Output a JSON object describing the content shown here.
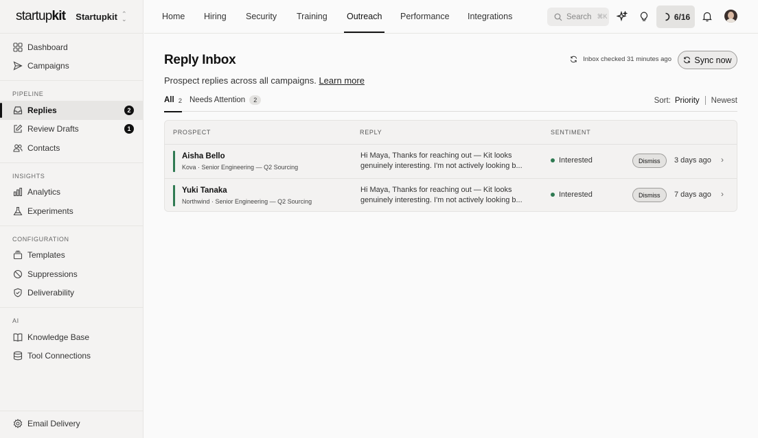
{
  "brand": {
    "logo_light": "startup",
    "logo_bold": "kit",
    "workspace": "Startupkit"
  },
  "sidebar": {
    "top_items": [
      {
        "label": "Dashboard",
        "icon": "grid-icon"
      },
      {
        "label": "Campaigns",
        "icon": "send-icon"
      }
    ],
    "sections": [
      {
        "title": "PIPELINE",
        "items": [
          {
            "label": "Replies",
            "icon": "inbox-icon",
            "badge": "2",
            "active": true
          },
          {
            "label": "Review Drafts",
            "icon": "edit-icon",
            "badge": "1"
          },
          {
            "label": "Contacts",
            "icon": "users-icon"
          }
        ]
      },
      {
        "title": "INSIGHTS",
        "items": [
          {
            "label": "Analytics",
            "icon": "bar-chart-icon"
          },
          {
            "label": "Experiments",
            "icon": "flask-icon"
          }
        ]
      },
      {
        "title": "CONFIGURATION",
        "items": [
          {
            "label": "Templates",
            "icon": "stack-icon"
          },
          {
            "label": "Suppressions",
            "icon": "ban-icon"
          },
          {
            "label": "Deliverability",
            "icon": "shield-check-icon"
          }
        ]
      },
      {
        "title": "AI",
        "items": [
          {
            "label": "Knowledge Base",
            "icon": "book-icon"
          },
          {
            "label": "Tool Connections",
            "icon": "database-icon"
          }
        ]
      }
    ],
    "bottom_item": {
      "label": "Email Delivery",
      "icon": "gear-icon"
    }
  },
  "topnav": {
    "tabs": [
      "Home",
      "Hiring",
      "Security",
      "Training",
      "Outreach",
      "Performance",
      "Integrations"
    ],
    "active_tab": "Outreach",
    "search_placeholder": "Search",
    "search_shortcut": "⌘K",
    "progress": "6/16"
  },
  "page": {
    "title": "Reply Inbox",
    "subtitle": "Prospect replies across all campaigns.",
    "learn_more": "Learn more",
    "checked_text": "Inbox checked 31 minutes ago",
    "sync_label": "Sync now"
  },
  "filters": {
    "all_label": "All",
    "all_count": "2",
    "needs_label": "Needs Attention",
    "needs_count": "2",
    "sort_label": "Sort:",
    "sort_priority": "Priority",
    "sort_newest": "Newest"
  },
  "table": {
    "columns": [
      "PROSPECT",
      "REPLY",
      "SENTIMENT"
    ],
    "rows": [
      {
        "name": "Aisha Bello",
        "meta": "Kova · Senior Engineering — Q2 Sourcing",
        "reply_line1": "Hi Maya, Thanks for reaching out — Kit looks",
        "reply_line2": "genuinely interesting. I'm not actively looking b...",
        "sentiment": "Interested",
        "dismiss": "Dismiss",
        "ago": "3 days ago"
      },
      {
        "name": "Yuki Tanaka",
        "meta": "Northwind · Senior Engineering — Q2 Sourcing",
        "reply_line1": "Hi Maya, Thanks for reaching out — Kit looks",
        "reply_line2": "genuinely interesting. I'm not actively looking b...",
        "sentiment": "Interested",
        "dismiss": "Dismiss",
        "ago": "7 days ago"
      }
    ]
  },
  "colors": {
    "accent_green": "#2f7a52",
    "active_black": "#111111"
  }
}
